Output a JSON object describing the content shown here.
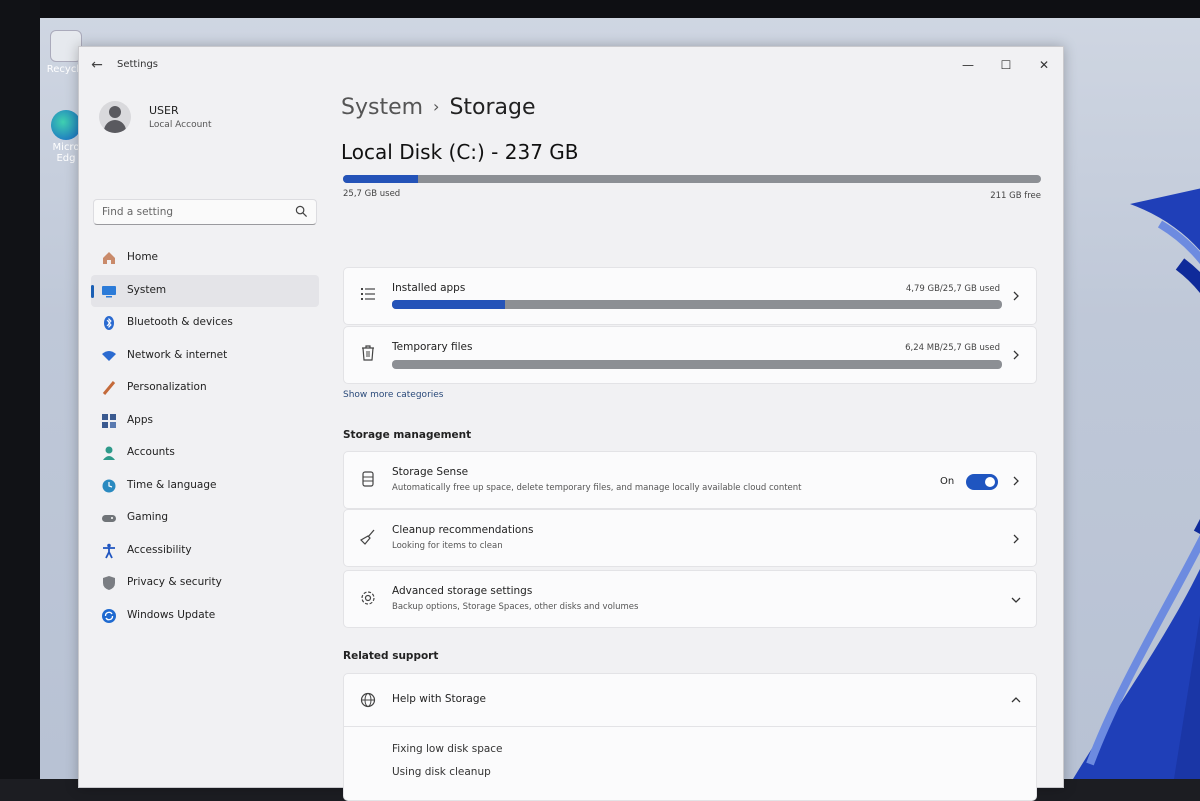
{
  "desktop": {
    "icons": [
      {
        "label": "Recycle"
      },
      {
        "label": "Micro Edg"
      }
    ]
  },
  "window": {
    "title": "Settings",
    "back_glyph": "←",
    "minimize_glyph": "—",
    "maximize_glyph": "☐",
    "close_glyph": "✕"
  },
  "profile": {
    "name": "USER",
    "account_type": "Local Account"
  },
  "search": {
    "placeholder": "Find a setting"
  },
  "nav": {
    "items": [
      {
        "label": "Home",
        "icon": "home-icon"
      },
      {
        "label": "System",
        "icon": "system-icon",
        "active": true
      },
      {
        "label": "Bluetooth & devices",
        "icon": "bluetooth-icon"
      },
      {
        "label": "Network & internet",
        "icon": "wifi-icon"
      },
      {
        "label": "Personalization",
        "icon": "brush-icon"
      },
      {
        "label": "Apps",
        "icon": "apps-icon"
      },
      {
        "label": "Accounts",
        "icon": "accounts-icon"
      },
      {
        "label": "Time & language",
        "icon": "globe-clock-icon"
      },
      {
        "label": "Gaming",
        "icon": "gamepad-icon"
      },
      {
        "label": "Accessibility",
        "icon": "accessibility-icon"
      },
      {
        "label": "Privacy & security",
        "icon": "shield-icon"
      },
      {
        "label": "Windows Update",
        "icon": "update-icon"
      }
    ]
  },
  "breadcrumb": {
    "parent": "System",
    "separator": "›",
    "current": "Storage"
  },
  "disk": {
    "title": "Local Disk (C:) - 237 GB",
    "used_label": "25,7 GB used",
    "free_label": "211 GB free",
    "used_fraction": 0.108
  },
  "categories": [
    {
      "title": "Installed apps",
      "meta": "4,79 GB/25,7 GB used",
      "fraction": 0.186,
      "icon": "list-icon"
    },
    {
      "title": "Temporary files",
      "meta": "6,24 MB/25,7 GB used",
      "fraction": 0.0,
      "icon": "trash-icon"
    }
  ],
  "show_more": "Show more categories",
  "storage_management": {
    "heading": "Storage management",
    "storage_sense": {
      "title": "Storage Sense",
      "subtitle": "Automatically free up space, delete temporary files, and manage locally available cloud content",
      "toggle_label": "On",
      "toggle_on": true
    },
    "cleanup": {
      "title": "Cleanup recommendations",
      "subtitle": "Looking for items to clean"
    },
    "advanced": {
      "title": "Advanced storage settings",
      "subtitle": "Backup options, Storage Spaces, other disks and volumes"
    }
  },
  "related_support": {
    "heading": "Related support",
    "help_title": "Help with Storage",
    "links": [
      "Fixing low disk space",
      "Using disk cleanup"
    ]
  },
  "colors": {
    "accent": "#2453b8",
    "toggle_on": "#1f55c0"
  }
}
